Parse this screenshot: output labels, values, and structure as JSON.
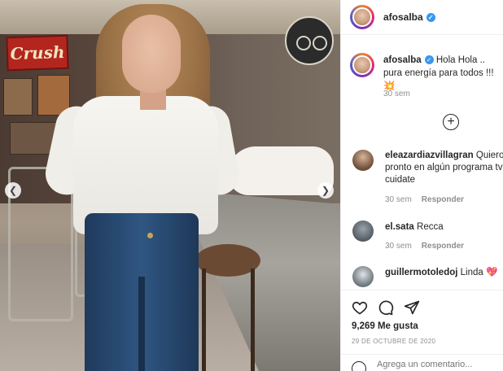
{
  "post": {
    "username": "afosalba",
    "verified": true,
    "caption_text": "Hola Hola .. pura energía para todos !!!💥",
    "caption_time": "30 sem",
    "likes": "9,269 Me gusta",
    "date": "29 DE OCTUBRE DE 2020",
    "add_comment_placeholder": "Agrega un comentario..."
  },
  "photo": {
    "sign_text": "Crush"
  },
  "comments": [
    {
      "username": "eleazardiazvillagran",
      "line1": "Quiero v",
      "line2": "pronto en algún programa tv",
      "line3": "cuidate",
      "time": "30 sem",
      "reply": "Responder"
    },
    {
      "username": "el.sata",
      "text": "Recca",
      "time": "30 sem",
      "reply": "Responder"
    },
    {
      "username": "guillermotoledoj",
      "text": "Linda 💖"
    }
  ],
  "icons": {
    "verified": "verified-badge-icon",
    "expand": "plus-circle-icon",
    "like": "heart-icon",
    "comment": "comment-icon",
    "share": "send-icon",
    "prev": "chevron-left-icon",
    "next": "chevron-right-icon",
    "emoji": "emoji-icon"
  },
  "colors": {
    "verified": "#3897f0",
    "text": "#262626",
    "muted": "#8e8e8e",
    "border": "#efefef"
  }
}
